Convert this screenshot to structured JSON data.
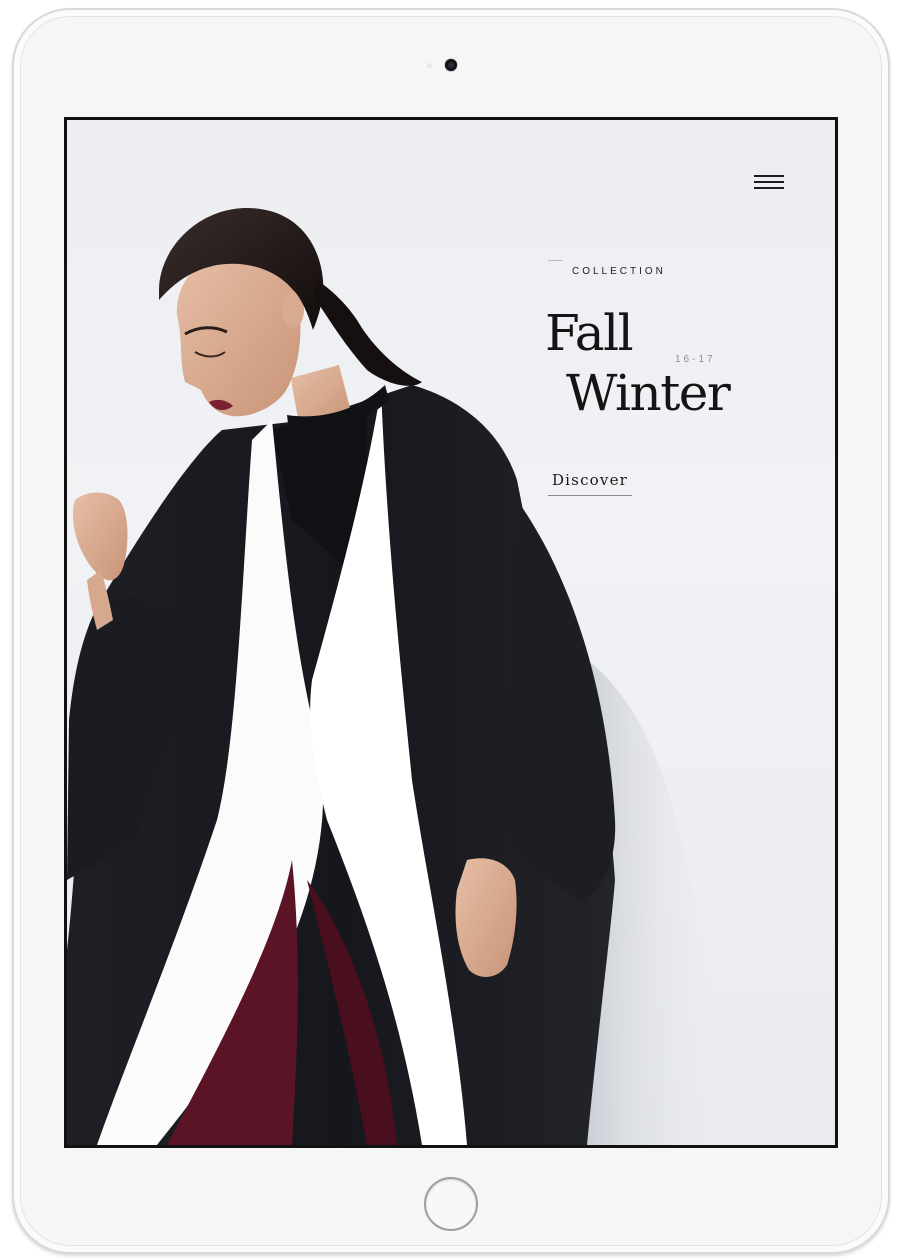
{
  "device": {
    "type": "tablet",
    "frame_color": "#f6f6f7"
  },
  "hero": {
    "collection_label": "COLLECTION",
    "title_line1": "Fall",
    "title_line2": "Winter",
    "season_years": "16-17",
    "cta_label": "Discover",
    "photo_subject": "fashion-model-in-black-and-white-coat"
  },
  "nav": {
    "menu_icon": "hamburger-menu-icon"
  },
  "colors": {
    "text": "#141414",
    "accent_coat": "#181a1f",
    "accent_lining": "#fbfbfb",
    "accent_trousers": "#5a1426",
    "background": "#eceef2"
  }
}
